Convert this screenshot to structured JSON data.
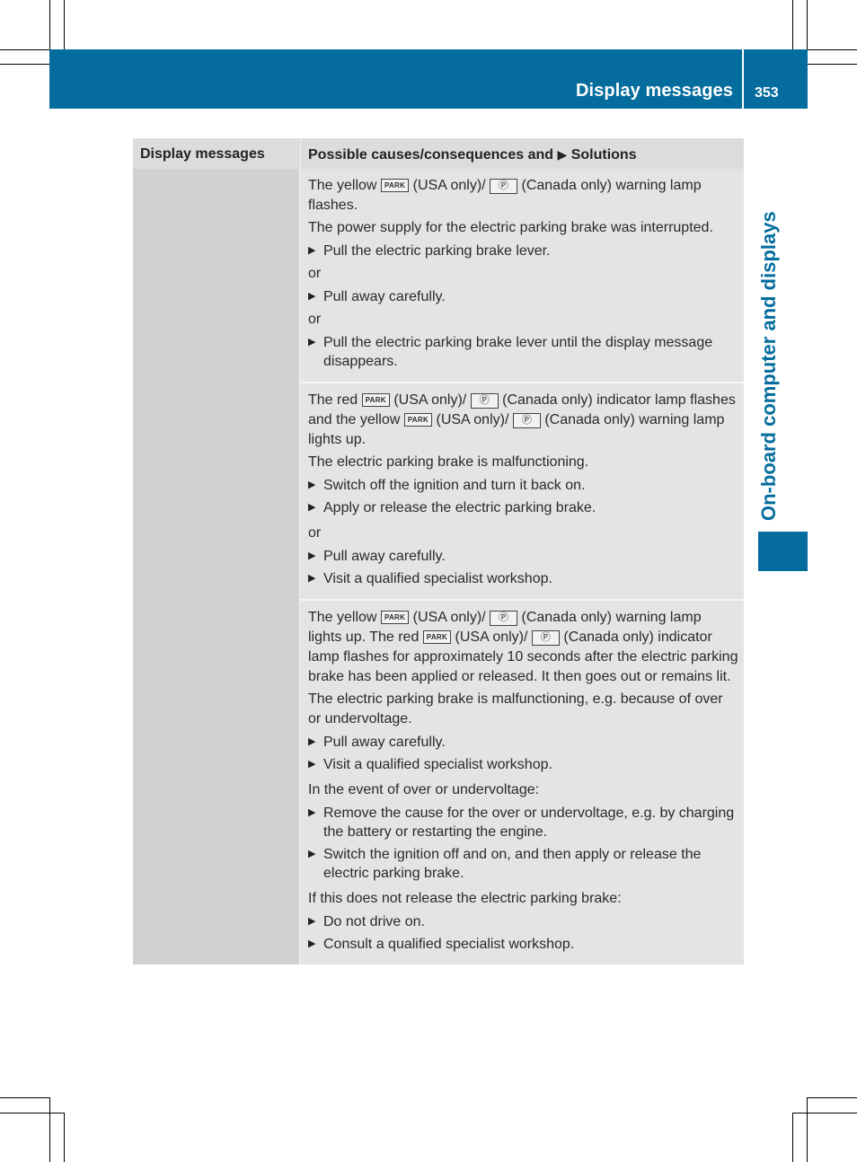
{
  "header": {
    "title": "Display messages",
    "page_number": "353"
  },
  "side_tab": {
    "label": "On-board computer and displays"
  },
  "colors": {
    "brand_blue": "#046d9d",
    "table_header": "#dcdcdc",
    "left_column": "#d1d1d1",
    "right_column": "#e4e4e4"
  },
  "icons": {
    "park_lamp": "PARK",
    "p_lamp": "Ⓟ",
    "solution_arrow": "▶"
  },
  "table": {
    "col1_header": "Display messages",
    "col2_header_pre": "Possible causes/consequences and",
    "col2_header_post": "Solutions",
    "blocks": [
      {
        "intro": {
          "t1": "The yellow",
          "t2": "(USA only)/",
          "t3": "(Canada only) warning lamp flashes."
        },
        "cause": "The power supply for the electric parking brake was interrupted.",
        "steps": [
          "Pull the electric parking brake lever.",
          "or",
          "Pull away carefully.",
          "or",
          "Pull the electric parking brake lever until the display message disappears."
        ]
      },
      {
        "intro": {
          "t1": "The red",
          "t2": "(USA only)/",
          "t3": "(Canada only) indicator lamp flashes and the yellow",
          "t4": "(USA only)/",
          "t5": "(Canada only) warning lamp lights up."
        },
        "cause": "The electric parking brake is malfunctioning.",
        "steps": [
          "Switch off the ignition and turn it back on.",
          "Apply or release the electric parking brake.",
          "or",
          "Pull away carefully.",
          "Visit a qualified specialist workshop."
        ]
      },
      {
        "intro": {
          "t1": "The yellow",
          "t2": "(USA only)/",
          "t3": "(Canada only) warning lamp lights up. The red",
          "t4": "(USA only)/",
          "t5": "(Canada only) indicator lamp flashes for approximately 10 seconds after the electric parking brake has been applied or released. It then goes out or remains lit."
        },
        "cause": "The electric parking brake is malfunctioning, e.g. because of over or undervoltage.",
        "steps": [
          "Pull away carefully.",
          "Visit a qualified specialist workshop."
        ],
        "sub1": "In the event of over or undervoltage:",
        "steps2": [
          "Remove the cause for the over or undervoltage, e.g. by charging the battery or restarting the engine.",
          "Switch the ignition off and on, and then apply or release the electric parking brake."
        ],
        "sub2": "If this does not release the electric parking brake:",
        "steps3": [
          "Do not drive on.",
          "Consult a qualified specialist workshop."
        ]
      }
    ]
  }
}
